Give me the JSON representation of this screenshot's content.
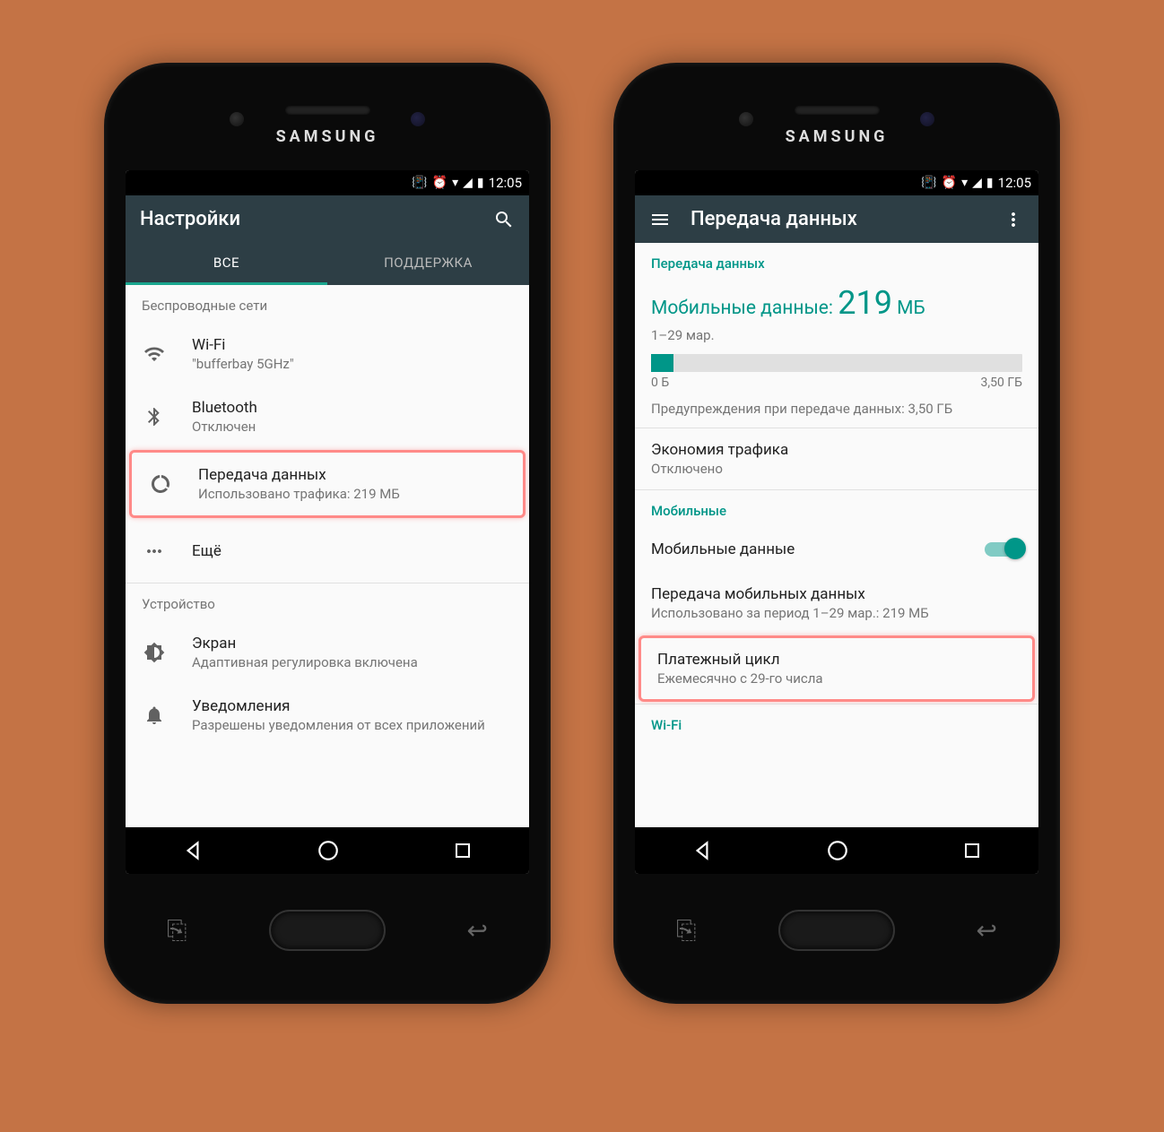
{
  "brand": "SAMSUNG",
  "status_time": "12:05",
  "left": {
    "title": "Настройки",
    "tabs": {
      "all": "ВСЕ",
      "support": "ПОДДЕРЖКА"
    },
    "section_wireless": "Беспроводные сети",
    "wifi": {
      "label": "Wi-Fi",
      "sub": "\"bufferbay 5GHz\""
    },
    "bluetooth": {
      "label": "Bluetooth",
      "sub": "Отключен"
    },
    "data": {
      "label": "Передача данных",
      "sub": "Использовано трафика: 219 МБ"
    },
    "more": {
      "label": "Ещё"
    },
    "section_device": "Устройство",
    "display": {
      "label": "Экран",
      "sub": "Адаптивная регулировка включена"
    },
    "notif": {
      "label": "Уведомления",
      "sub": "Разрешены уведомления от всех приложений"
    }
  },
  "right": {
    "title": "Передача данных",
    "sec_data": "Передача данных",
    "mobile_label": "Мобильные данные: ",
    "mobile_value": "219",
    "mobile_unit": " МБ",
    "period": "1–29 мар.",
    "progress_min": "0 Б",
    "progress_max": "3,50 ГБ",
    "warning": "Предупреждения при передаче данных: 3,50 ГБ",
    "saver": {
      "label": "Экономия трафика",
      "sub": "Отключено"
    },
    "sec_mobile": "Мобильные",
    "mobile_toggle": "Мобильные данные",
    "mobile_usage": {
      "label": "Передача мобильных данных",
      "sub": "Использовано за период 1–29 мар.: 219 МБ"
    },
    "billing": {
      "label": "Платежный цикл",
      "sub": "Ежемесячно с 29-го числа"
    },
    "sec_wifi": "Wi-Fi"
  }
}
